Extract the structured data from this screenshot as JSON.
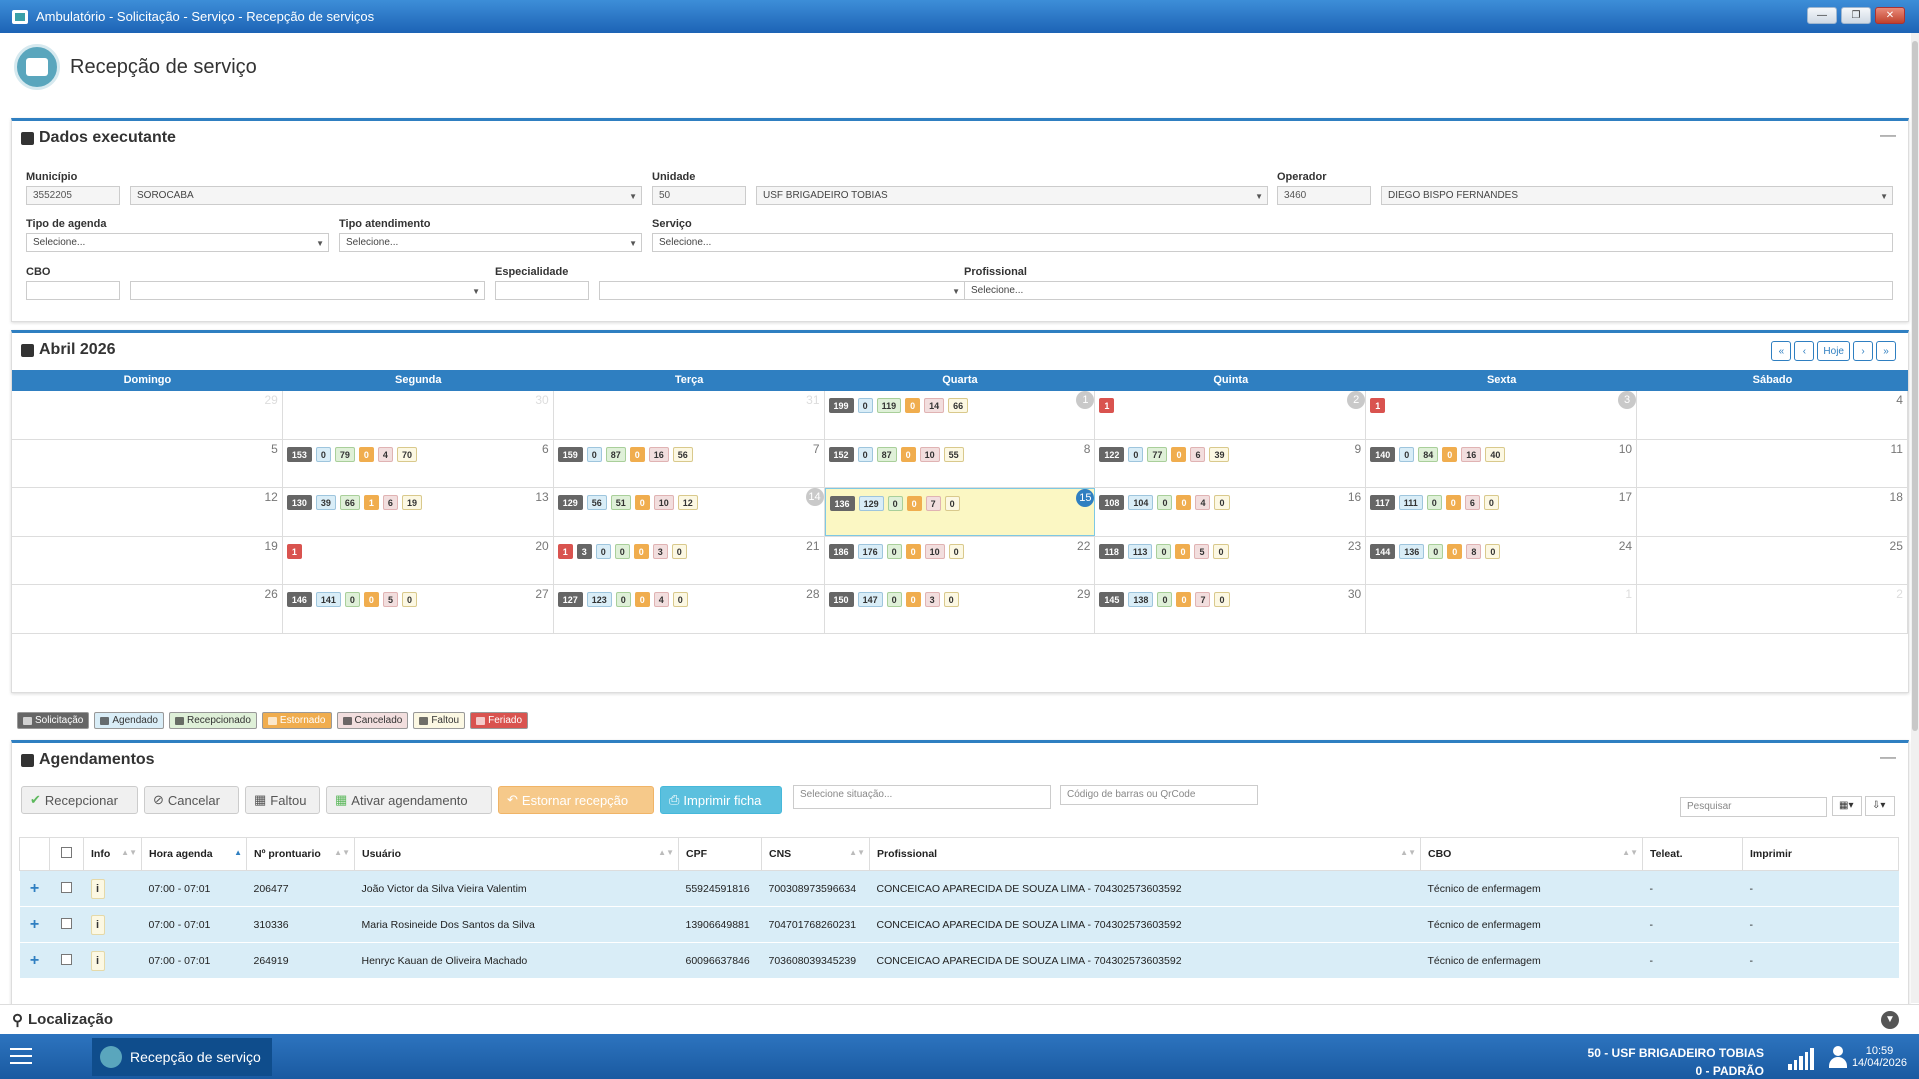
{
  "window": {
    "title": "Ambulatório - Solicitação - Serviço - Recepção de serviços",
    "btn_min": "—",
    "btn_max": "❐",
    "btn_close": "✕"
  },
  "page": {
    "title": "Recepção de serviço"
  },
  "dados": {
    "title": "Dados executante",
    "collapse": "—",
    "municipio": {
      "label": "Município",
      "code": "3552205",
      "name": "SOROCABA"
    },
    "unidade": {
      "label": "Unidade",
      "code": "50",
      "name": "USF BRIGADEIRO TOBIAS"
    },
    "operador": {
      "label": "Operador",
      "code": "3460",
      "name": "DIEGO BISPO FERNANDES"
    },
    "tipo_agenda": {
      "label": "Tipo de agenda",
      "value": "Selecione..."
    },
    "tipo_atendimento": {
      "label": "Tipo atendimento",
      "value": "Selecione..."
    },
    "servico": {
      "label": "Serviço",
      "value": "Selecione..."
    },
    "cbo": {
      "label": "CBO",
      "code": "",
      "name": ""
    },
    "especialidade": {
      "label": "Especialidade",
      "code": "",
      "name": ""
    },
    "profissional": {
      "label": "Profissional",
      "value": "Selecione..."
    }
  },
  "calendar": {
    "title": "Abril 2026",
    "nav": [
      "«",
      "‹",
      "Hoje",
      "›",
      "»"
    ],
    "weekdays": [
      "Domingo",
      "Segunda",
      "Terça",
      "Quarta",
      "Quinta",
      "Sexta",
      "Sábado"
    ],
    "weeks": [
      [
        {
          "d": "29",
          "o": true
        },
        {
          "d": "30",
          "o": true
        },
        {
          "d": "31",
          "o": true
        },
        {
          "d": "1",
          "h": true,
          "b": [
            [
              "s",
              "199"
            ],
            [
              "a",
              "0"
            ],
            [
              "r",
              "119"
            ],
            [
              "e",
              "0"
            ],
            [
              "c",
              "14"
            ],
            [
              "f",
              "66"
            ]
          ]
        },
        {
          "d": "2",
          "h": true,
          "b": [
            [
              "h",
              "1"
            ]
          ]
        },
        {
          "d": "3",
          "h": true,
          "b": [
            [
              "h",
              "1"
            ]
          ]
        },
        {
          "d": "4"
        }
      ],
      [
        {
          "d": "5"
        },
        {
          "d": "6",
          "b": [
            [
              "s",
              "153"
            ],
            [
              "a",
              "0"
            ],
            [
              "r",
              "79"
            ],
            [
              "e",
              "0"
            ],
            [
              "c",
              "4"
            ],
            [
              "f",
              "70"
            ]
          ]
        },
        {
          "d": "7",
          "b": [
            [
              "s",
              "159"
            ],
            [
              "a",
              "0"
            ],
            [
              "r",
              "87"
            ],
            [
              "e",
              "0"
            ],
            [
              "c",
              "16"
            ],
            [
              "f",
              "56"
            ]
          ]
        },
        {
          "d": "8",
          "b": [
            [
              "s",
              "152"
            ],
            [
              "a",
              "0"
            ],
            [
              "r",
              "87"
            ],
            [
              "e",
              "0"
            ],
            [
              "c",
              "10"
            ],
            [
              "f",
              "55"
            ]
          ]
        },
        {
          "d": "9",
          "b": [
            [
              "s",
              "122"
            ],
            [
              "a",
              "0"
            ],
            [
              "r",
              "77"
            ],
            [
              "e",
              "0"
            ],
            [
              "c",
              "6"
            ],
            [
              "f",
              "39"
            ]
          ]
        },
        {
          "d": "10",
          "b": [
            [
              "s",
              "140"
            ],
            [
              "a",
              "0"
            ],
            [
              "r",
              "84"
            ],
            [
              "e",
              "0"
            ],
            [
              "c",
              "16"
            ],
            [
              "f",
              "40"
            ]
          ]
        },
        {
          "d": "11"
        }
      ],
      [
        {
          "d": "12"
        },
        {
          "d": "13",
          "b": [
            [
              "s",
              "130"
            ],
            [
              "a",
              "39"
            ],
            [
              "r",
              "66"
            ],
            [
              "e",
              "1"
            ],
            [
              "c",
              "6"
            ],
            [
              "f",
              "19"
            ]
          ]
        },
        {
          "d": "14",
          "hn": true,
          "b": [
            [
              "s",
              "129"
            ],
            [
              "a",
              "56"
            ],
            [
              "r",
              "51"
            ],
            [
              "e",
              "0"
            ],
            [
              "c",
              "10"
            ],
            [
              "f",
              "12"
            ]
          ]
        },
        {
          "d": "15",
          "t": true,
          "b": [
            [
              "s",
              "136"
            ],
            [
              "a",
              "129"
            ],
            [
              "r",
              "0"
            ],
            [
              "e",
              "0"
            ],
            [
              "c",
              "7"
            ],
            [
              "f",
              "0"
            ]
          ]
        },
        {
          "d": "16",
          "b": [
            [
              "s",
              "108"
            ],
            [
              "a",
              "104"
            ],
            [
              "r",
              "0"
            ],
            [
              "e",
              "0"
            ],
            [
              "c",
              "4"
            ],
            [
              "f",
              "0"
            ]
          ]
        },
        {
          "d": "17",
          "b": [
            [
              "s",
              "117"
            ],
            [
              "a",
              "111"
            ],
            [
              "r",
              "0"
            ],
            [
              "e",
              "0"
            ],
            [
              "c",
              "6"
            ],
            [
              "f",
              "0"
            ]
          ]
        },
        {
          "d": "18"
        }
      ],
      [
        {
          "d": "19"
        },
        {
          "d": "20",
          "b": [
            [
              "h",
              "1"
            ]
          ]
        },
        {
          "d": "21",
          "b": [
            [
              "h",
              "1"
            ],
            [
              "s",
              "3"
            ],
            [
              "a",
              "0"
            ],
            [
              "r",
              "0"
            ],
            [
              "e",
              "0"
            ],
            [
              "c",
              "3"
            ],
            [
              "f",
              "0"
            ]
          ]
        },
        {
          "d": "22",
          "b": [
            [
              "s",
              "186"
            ],
            [
              "a",
              "176"
            ],
            [
              "r",
              "0"
            ],
            [
              "e",
              "0"
            ],
            [
              "c",
              "10"
            ],
            [
              "f",
              "0"
            ]
          ]
        },
        {
          "d": "23",
          "b": [
            [
              "s",
              "118"
            ],
            [
              "a",
              "113"
            ],
            [
              "r",
              "0"
            ],
            [
              "e",
              "0"
            ],
            [
              "c",
              "5"
            ],
            [
              "f",
              "0"
            ]
          ]
        },
        {
          "d": "24",
          "b": [
            [
              "s",
              "144"
            ],
            [
              "a",
              "136"
            ],
            [
              "r",
              "0"
            ],
            [
              "e",
              "0"
            ],
            [
              "c",
              "8"
            ],
            [
              "f",
              "0"
            ]
          ]
        },
        {
          "d": "25"
        }
      ],
      [
        {
          "d": "26"
        },
        {
          "d": "27",
          "b": [
            [
              "s",
              "146"
            ],
            [
              "a",
              "141"
            ],
            [
              "r",
              "0"
            ],
            [
              "e",
              "0"
            ],
            [
              "c",
              "5"
            ],
            [
              "f",
              "0"
            ]
          ]
        },
        {
          "d": "28",
          "b": [
            [
              "s",
              "127"
            ],
            [
              "a",
              "123"
            ],
            [
              "r",
              "0"
            ],
            [
              "e",
              "0"
            ],
            [
              "c",
              "4"
            ],
            [
              "f",
              "0"
            ]
          ]
        },
        {
          "d": "29",
          "b": [
            [
              "s",
              "150"
            ],
            [
              "a",
              "147"
            ],
            [
              "r",
              "0"
            ],
            [
              "e",
              "0"
            ],
            [
              "c",
              "3"
            ],
            [
              "f",
              "0"
            ]
          ]
        },
        {
          "d": "30",
          "b": [
            [
              "s",
              "145"
            ],
            [
              "a",
              "138"
            ],
            [
              "r",
              "0"
            ],
            [
              "e",
              "0"
            ],
            [
              "c",
              "7"
            ],
            [
              "f",
              "0"
            ]
          ]
        },
        {
          "d": "1",
          "o": true
        },
        {
          "d": "2",
          "o": true
        }
      ]
    ]
  },
  "legend": [
    {
      "label": "Solicitação",
      "cls": "b-s"
    },
    {
      "label": "Agendado",
      "cls": "b-a"
    },
    {
      "label": "Recepcionado",
      "cls": "b-r"
    },
    {
      "label": "Estornado",
      "cls": "b-e"
    },
    {
      "label": "Cancelado",
      "cls": "b-c"
    },
    {
      "label": "Faltou",
      "cls": "b-f"
    },
    {
      "label": "Feriado",
      "cls": "b-h"
    }
  ],
  "agend": {
    "title": "Agendamentos",
    "collapse": "—",
    "buttons": {
      "recepcionar": "Recepcionar",
      "cancelar": "Cancelar",
      "faltou": "Faltou",
      "ativar": "Ativar agendamento",
      "estornar": "Estornar recepção",
      "imprimir": "Imprimir ficha"
    },
    "situacao_placeholder": "Selecione situação...",
    "barcode_placeholder": "Código de barras ou QrCode",
    "search_placeholder": "Pesquisar",
    "columns": [
      "Info",
      "Hora agenda",
      "Nº prontuario",
      "Usuário",
      "CPF",
      "CNS",
      "Profissional",
      "CBO",
      "Teleat.",
      "Imprimir"
    ],
    "rows": [
      {
        "hora": "07:00 - 07:01",
        "pront": "206477",
        "usuario": "João Victor da Silva Vieira Valentim",
        "cpf": "55924591816",
        "cns": "700308973596634",
        "prof": "CONCEICAO APARECIDA DE SOUZA LIMA - 704302573603592",
        "cbo": "Técnico de enfermagem",
        "tele": "-",
        "impr": "-"
      },
      {
        "hora": "07:00 - 07:01",
        "pront": "310336",
        "usuario": "Maria Rosineide Dos Santos da Silva",
        "cpf": "13906649881",
        "cns": "704701768260231",
        "prof": "CONCEICAO APARECIDA DE SOUZA LIMA - 704302573603592",
        "cbo": "Técnico de enfermagem",
        "tele": "-",
        "impr": "-"
      },
      {
        "hora": "07:00 - 07:01",
        "pront": "264919",
        "usuario": "Henryc Kauan de Oliveira Machado",
        "cpf": "60096637846",
        "cns": "703608039345239",
        "prof": "CONCEICAO APARECIDA DE SOUZA LIMA - 704302573603592",
        "cbo": "Técnico de enfermagem",
        "tele": "-",
        "impr": "-"
      }
    ]
  },
  "localizacao": {
    "title": "Localização"
  },
  "taskbar": {
    "task": "Recepção de serviço",
    "unit": "50 - USF BRIGADEIRO TOBIAS",
    "profile": "0 - PADRÃO",
    "time": "10:59",
    "date": "14/04/2026"
  }
}
